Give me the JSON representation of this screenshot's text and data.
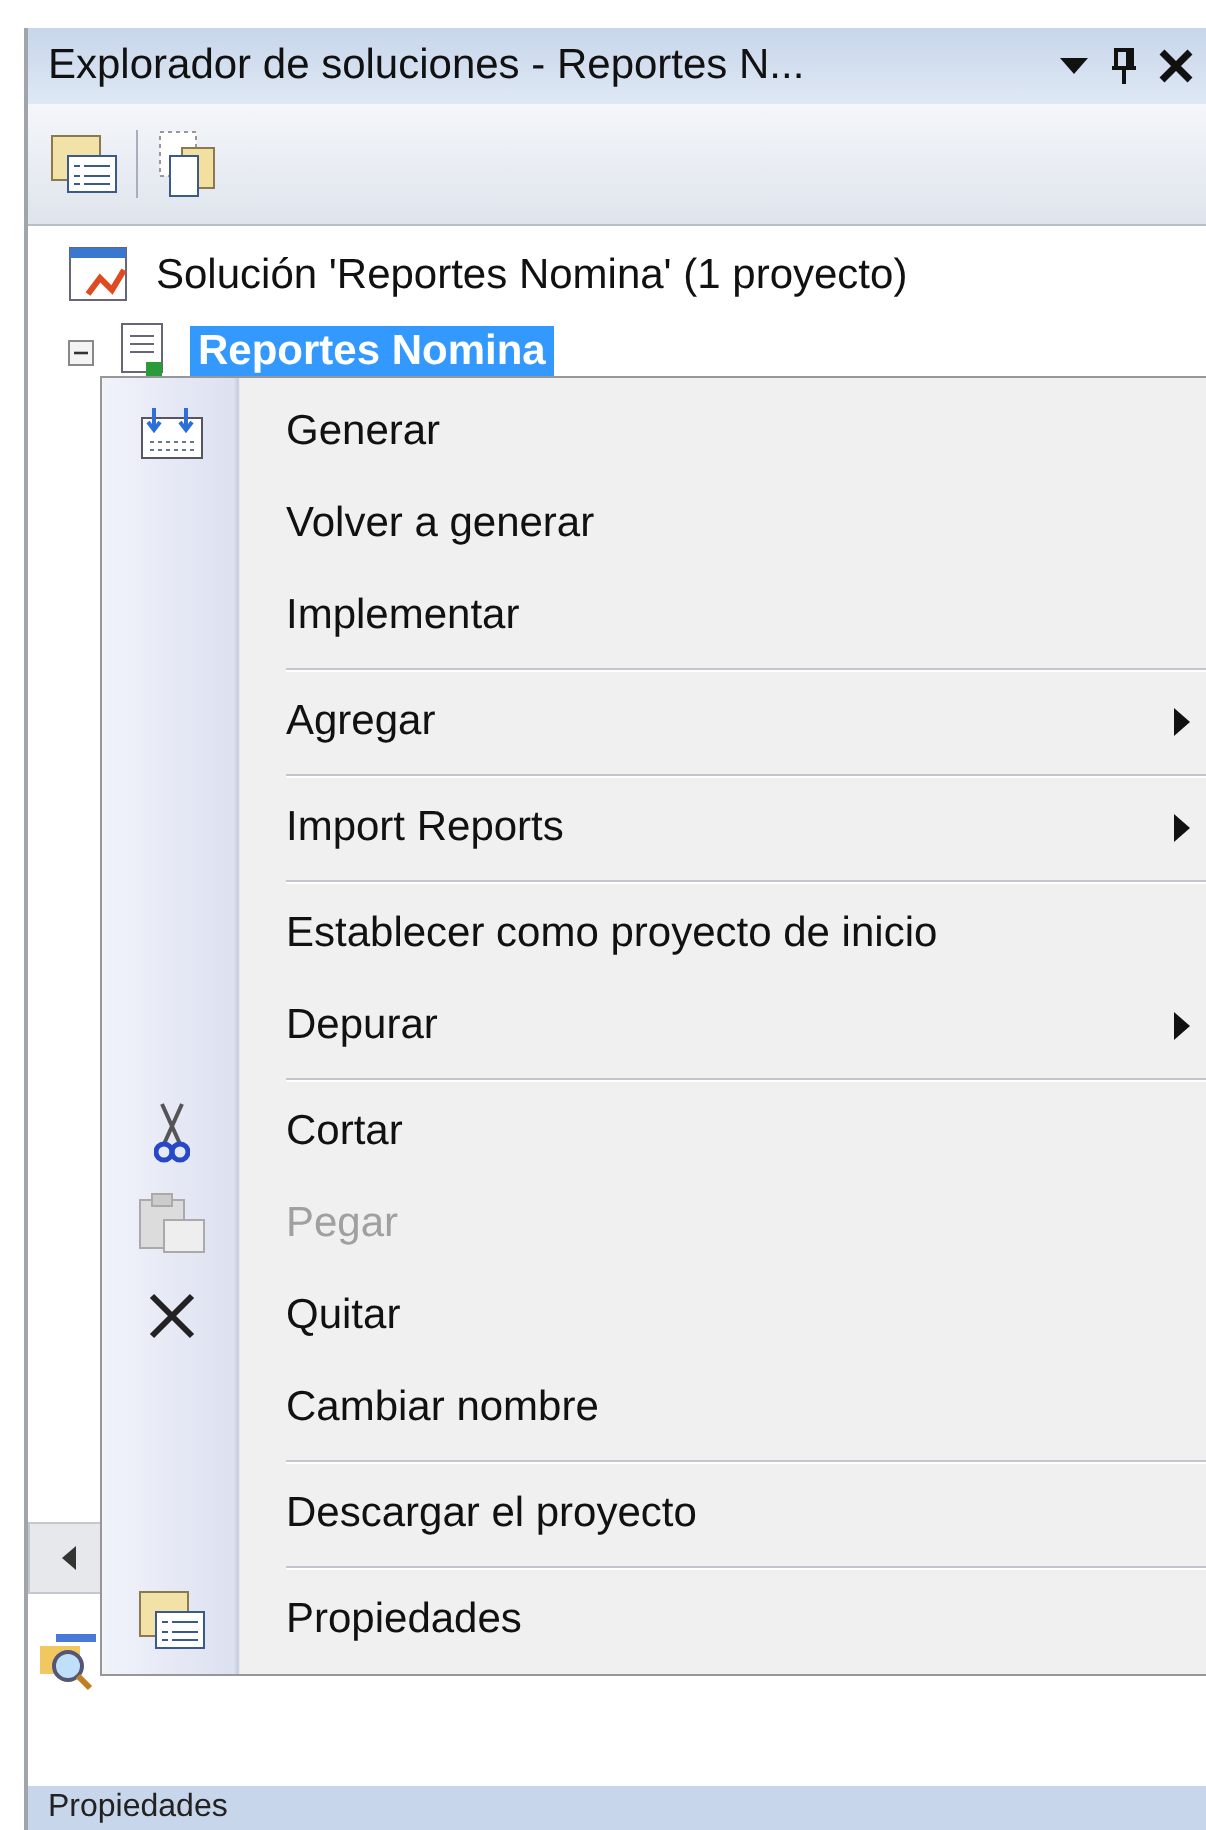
{
  "panel": {
    "title": "Explorador de soluciones - Reportes N...",
    "tree": [
      {
        "label": "Solución 'Reportes Nomina'  (1 proyecto)",
        "selected": false,
        "children": [
          {
            "label": "Reportes Nomina",
            "selected": true,
            "expanded": true
          }
        ]
      }
    ]
  },
  "context_menu": {
    "items": [
      {
        "kind": "item",
        "label": "Generar",
        "disabled": false,
        "submenu": false
      },
      {
        "kind": "item",
        "label": "Volver a generar",
        "disabled": false,
        "submenu": false
      },
      {
        "kind": "item",
        "label": "Implementar",
        "disabled": false,
        "submenu": false
      },
      {
        "kind": "separator"
      },
      {
        "kind": "item",
        "label": "Agregar",
        "disabled": false,
        "submenu": true
      },
      {
        "kind": "separator"
      },
      {
        "kind": "item",
        "label": "Import Reports",
        "disabled": false,
        "submenu": true
      },
      {
        "kind": "separator"
      },
      {
        "kind": "item",
        "label": "Establecer como proyecto de inicio",
        "disabled": false,
        "submenu": false
      },
      {
        "kind": "item",
        "label": "Depurar",
        "disabled": false,
        "submenu": true
      },
      {
        "kind": "separator"
      },
      {
        "kind": "item",
        "label": "Cortar",
        "disabled": false,
        "submenu": false
      },
      {
        "kind": "item",
        "label": "Pegar",
        "disabled": true,
        "submenu": false
      },
      {
        "kind": "item",
        "label": "Quitar",
        "disabled": false,
        "submenu": false
      },
      {
        "kind": "item",
        "label": "Cambiar nombre",
        "disabled": false,
        "submenu": false
      },
      {
        "kind": "separator"
      },
      {
        "kind": "item",
        "label": "Descargar el proyecto",
        "disabled": false,
        "submenu": false
      },
      {
        "kind": "separator"
      },
      {
        "kind": "item",
        "label": "Propiedades",
        "disabled": false,
        "submenu": false
      }
    ]
  },
  "bottom_panel": {
    "title": "Propiedades"
  }
}
